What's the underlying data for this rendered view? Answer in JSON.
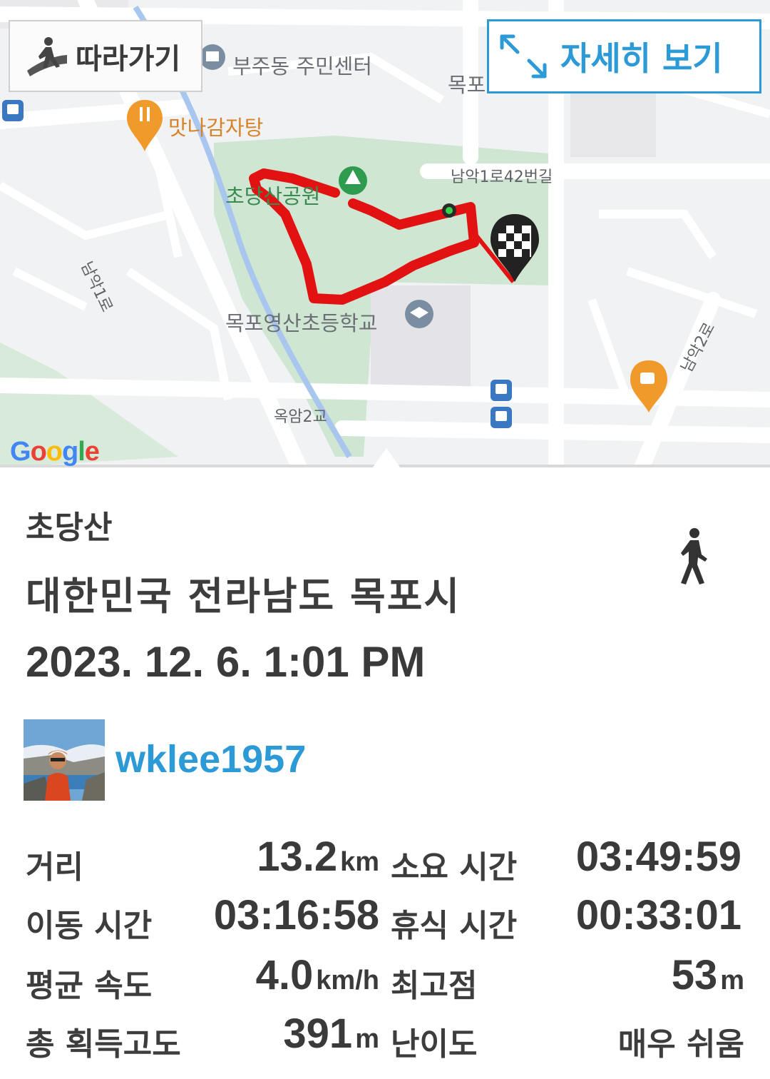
{
  "map": {
    "follow_button": "따라가기",
    "detail_button": "자세히 보기",
    "labels": {
      "community_center": "부주동 주민센터",
      "mokpo_partial": "목포",
      "restaurant": "맛나감자탕",
      "park": "초당산공원",
      "road_42": "남악1로42번길",
      "road_1": "남악1로",
      "school": "목포영산초등학교",
      "road_2": "남악2로",
      "bridge": "옥암2교"
    },
    "attribution": "Google",
    "colors": {
      "route": "#e31212",
      "water": "#a9c6ef",
      "park": "#cfe6d2",
      "accent": "#2b9ad6"
    }
  },
  "info": {
    "trail_name": "초당산",
    "location": "대한민국 전라남도 목포시",
    "datetime": "2023. 12. 6. 1:01 PM",
    "username": "wklee1957",
    "activity_icon": "walking-person-icon"
  },
  "stats": {
    "distance": {
      "label": "거리",
      "value": "13.2",
      "unit": "km"
    },
    "total_time": {
      "label": "소요 시간",
      "value": "03:49:59"
    },
    "moving_time": {
      "label": "이동 시간",
      "value": "03:16:58"
    },
    "rest_time": {
      "label": "휴식 시간",
      "value": "00:33:01"
    },
    "avg_speed": {
      "label": "평균 속도",
      "value": "4.0",
      "unit": "km/h"
    },
    "max_elevation": {
      "label": "최고점",
      "value": "53",
      "unit": "m"
    },
    "total_ascent": {
      "label": "총 획득고도",
      "value": "391",
      "unit": "m"
    },
    "difficulty": {
      "label": "난이도",
      "value": "매우 쉬움"
    }
  }
}
